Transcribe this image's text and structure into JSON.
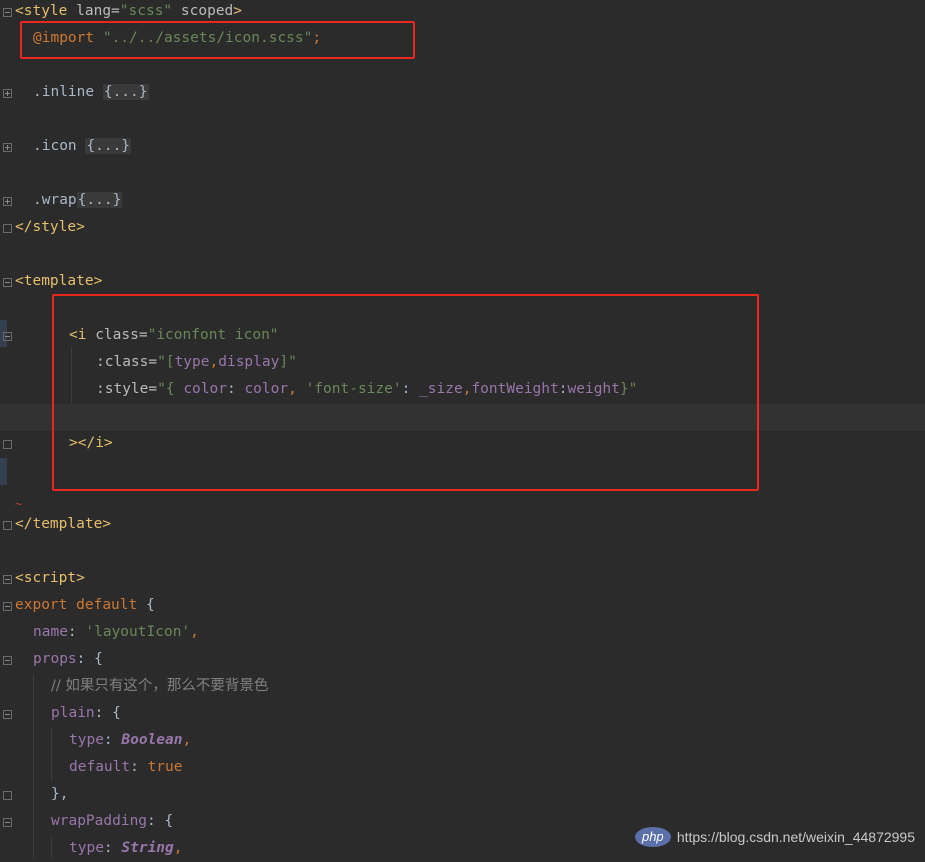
{
  "lines": {
    "l1": [
      "<style",
      "lang=",
      "\"scss\"",
      "scoped",
      ">"
    ],
    "l2": [
      "@import",
      "\"../../assets/icon.scss\"",
      ";"
    ],
    "l3": [
      ".inline",
      "{...}"
    ],
    "l4": [
      ".icon",
      "{...}"
    ],
    "l5": [
      ".wrap",
      "{...}"
    ],
    "l6": "</style>",
    "l7": "<template>",
    "l8": [
      "<i",
      "class=",
      "\"iconfont icon\""
    ],
    "l9": [
      ":class=",
      "\"[",
      "type",
      ",",
      "display",
      "]\""
    ],
    "l10": [
      ":style=",
      "\"{ ",
      "color",
      ": ",
      "color",
      ", ",
      "'font-size'",
      ": ",
      "_size",
      ",",
      "fontWeight",
      ":",
      "weight",
      "}\""
    ],
    "l11": "></i>",
    "l12": "</template>",
    "l13": "<script>",
    "l14": [
      "export",
      "default",
      "{"
    ],
    "l15": [
      "name",
      ": ",
      "'layoutIcon'",
      ","
    ],
    "l16": [
      "props",
      ": {"
    ],
    "l17": "// 如果只有这个，那么不要背景色",
    "l18": [
      "plain",
      ": {"
    ],
    "l19": [
      "type",
      ": ",
      "Boolean",
      ","
    ],
    "l20": [
      "default",
      ": ",
      "true"
    ],
    "l21": "},",
    "l22": [
      "wrapPadding",
      ": {"
    ],
    "l23": [
      "type",
      ": ",
      "String",
      ","
    ]
  },
  "tilde": "~",
  "watermark": {
    "badge": "php",
    "url": "https://blog.csdn.net/weixin_44872995"
  },
  "colors": {
    "background": "#2b2b2b",
    "tag": "#e8bf6a",
    "string": "#6a8759",
    "keyword": "#cc7832",
    "property": "#9876aa",
    "comment": "#808080",
    "highlight_box": "#e8281e"
  }
}
